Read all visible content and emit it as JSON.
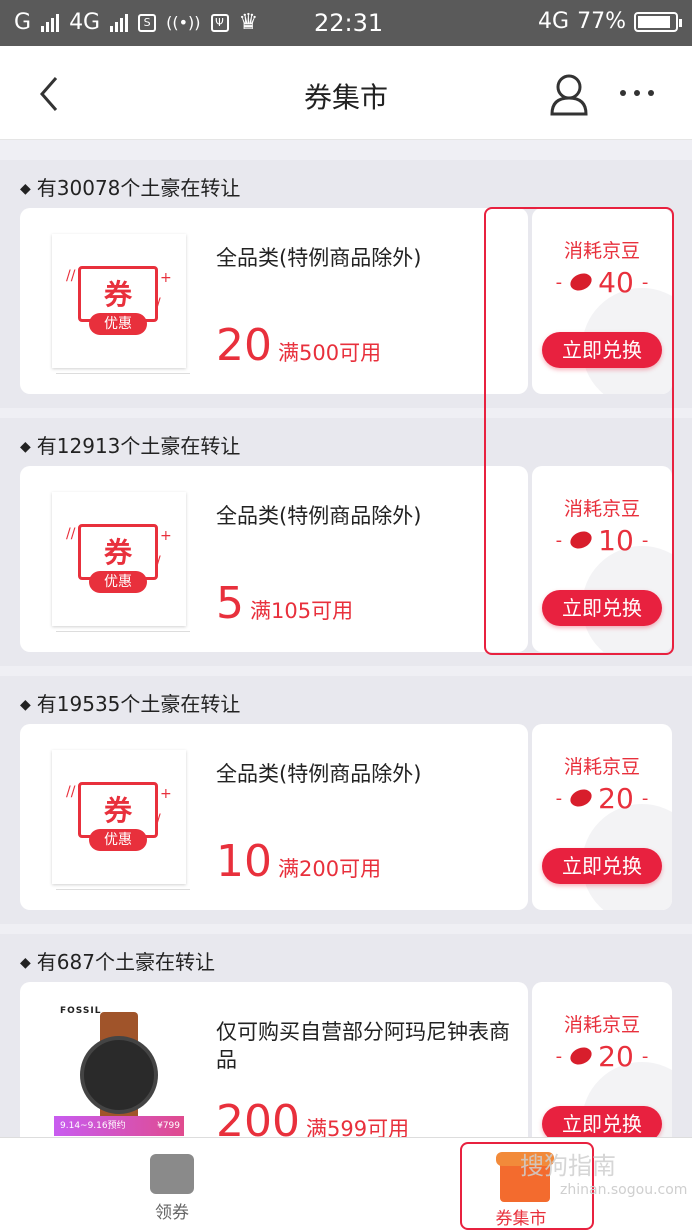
{
  "status_bar": {
    "carrier1": "G",
    "net2": "4G",
    "time": "22:31",
    "net_right": "4G",
    "battery": "77%"
  },
  "header": {
    "title": "券集市",
    "back_icon": "chevron-left-icon",
    "user_icon": "user-icon",
    "more_icon": "more-dots-icon"
  },
  "sections": [
    {
      "head": "有30078个土豪在转让",
      "name": "全品类(特例商品除外)",
      "value": "20",
      "condition": "满500可用",
      "cost_label": "消耗京豆",
      "cost": "40",
      "button": "立即兑换"
    },
    {
      "head": "有12913个土豪在转让",
      "name": "全品类(特例商品除外)",
      "value": "5",
      "condition": "满105可用",
      "cost_label": "消耗京豆",
      "cost": "10",
      "button": "立即兑换"
    },
    {
      "head": "有19535个土豪在转让",
      "name": "全品类(特例商品除外)",
      "value": "10",
      "condition": "满200可用",
      "cost_label": "消耗京豆",
      "cost": "20",
      "button": "立即兑换"
    },
    {
      "head": "有687个土豪在转让",
      "name": "仅可购买自营部分阿玛尼钟表商品",
      "value": "200",
      "condition": "满599可用",
      "cost_label": "消耗京豆",
      "cost": "20",
      "button": "立即兑换"
    }
  ],
  "coupon_graphic": {
    "main": "券",
    "sub": "优惠"
  },
  "watch_promo": {
    "brand": "FOSSIL",
    "dates": "9.14~9.16预约",
    "price": "¥799"
  },
  "tabbar": {
    "tab1": "领券",
    "tab2": "券集市"
  },
  "watermark": {
    "line1": "搜狗指南",
    "line2": "zhinan.sogou.com"
  },
  "colors": {
    "accent": "#e8213f",
    "text": "#222222",
    "bg": "#efeff4"
  }
}
